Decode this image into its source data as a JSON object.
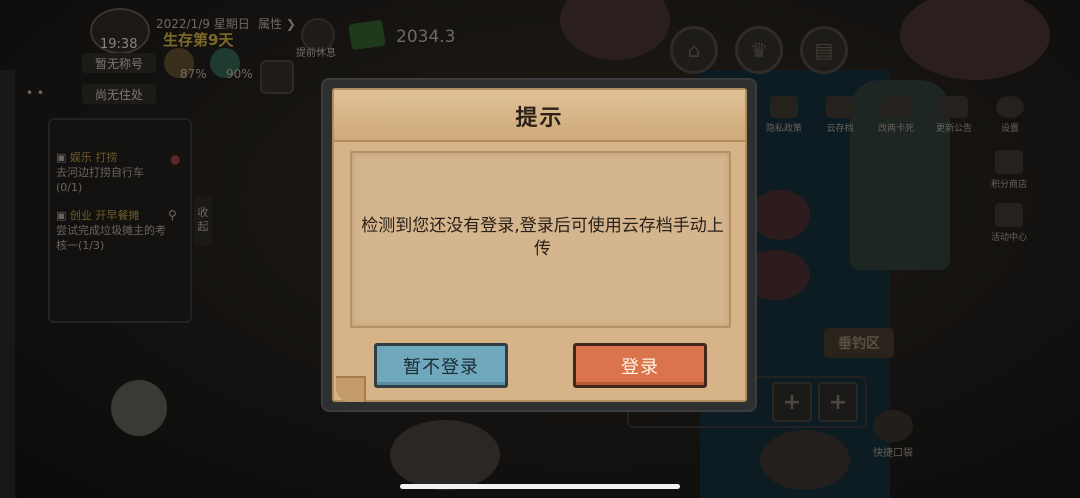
{
  "hud": {
    "date": "2022/1/9 星期日",
    "attr_label": "属性 ❯",
    "time": "19:38",
    "survival": "生存第9天",
    "title_pill": "暂无称号",
    "home_pill": "尚无住处",
    "stat1": "87%",
    "stat2": "90%",
    "rest_label": "提前休息",
    "money": "2034.3",
    "left_dots": "• •"
  },
  "quests": [
    {
      "tag": "娱乐",
      "title": "打捞",
      "desc": "去河边打捞自行车",
      "progress": "(0/1)"
    },
    {
      "tag": "创业",
      "title": "开早餐摊",
      "desc": "尝试完成垃圾摊主的考核一(1/3)",
      "progress": ""
    }
  ],
  "collapse_label": "收起",
  "right_menu": [
    {
      "id": "privacy",
      "label": "隐私政策"
    },
    {
      "id": "cloud",
      "label": "云存档"
    },
    {
      "id": "redeem",
      "label": "改两卡死"
    },
    {
      "id": "notice",
      "label": "更新公告"
    },
    {
      "id": "settings",
      "label": "设置"
    }
  ],
  "side_buttons": [
    {
      "id": "points-shop",
      "label": "积分商店"
    },
    {
      "id": "events",
      "label": "活动中心"
    }
  ],
  "sign_text": "垂钓区",
  "quick_bag": "快捷口袋",
  "slot_plus": "+",
  "dialog": {
    "title": "提示",
    "message": "检测到您还没有登录,登录后可使用云存档手动上传",
    "cancel_label": "暂不登录",
    "login_label": "登录"
  },
  "colors": {
    "cancel_button": "#6fa8bd",
    "login_button": "#d9744c",
    "parchment": "#d6b488"
  }
}
